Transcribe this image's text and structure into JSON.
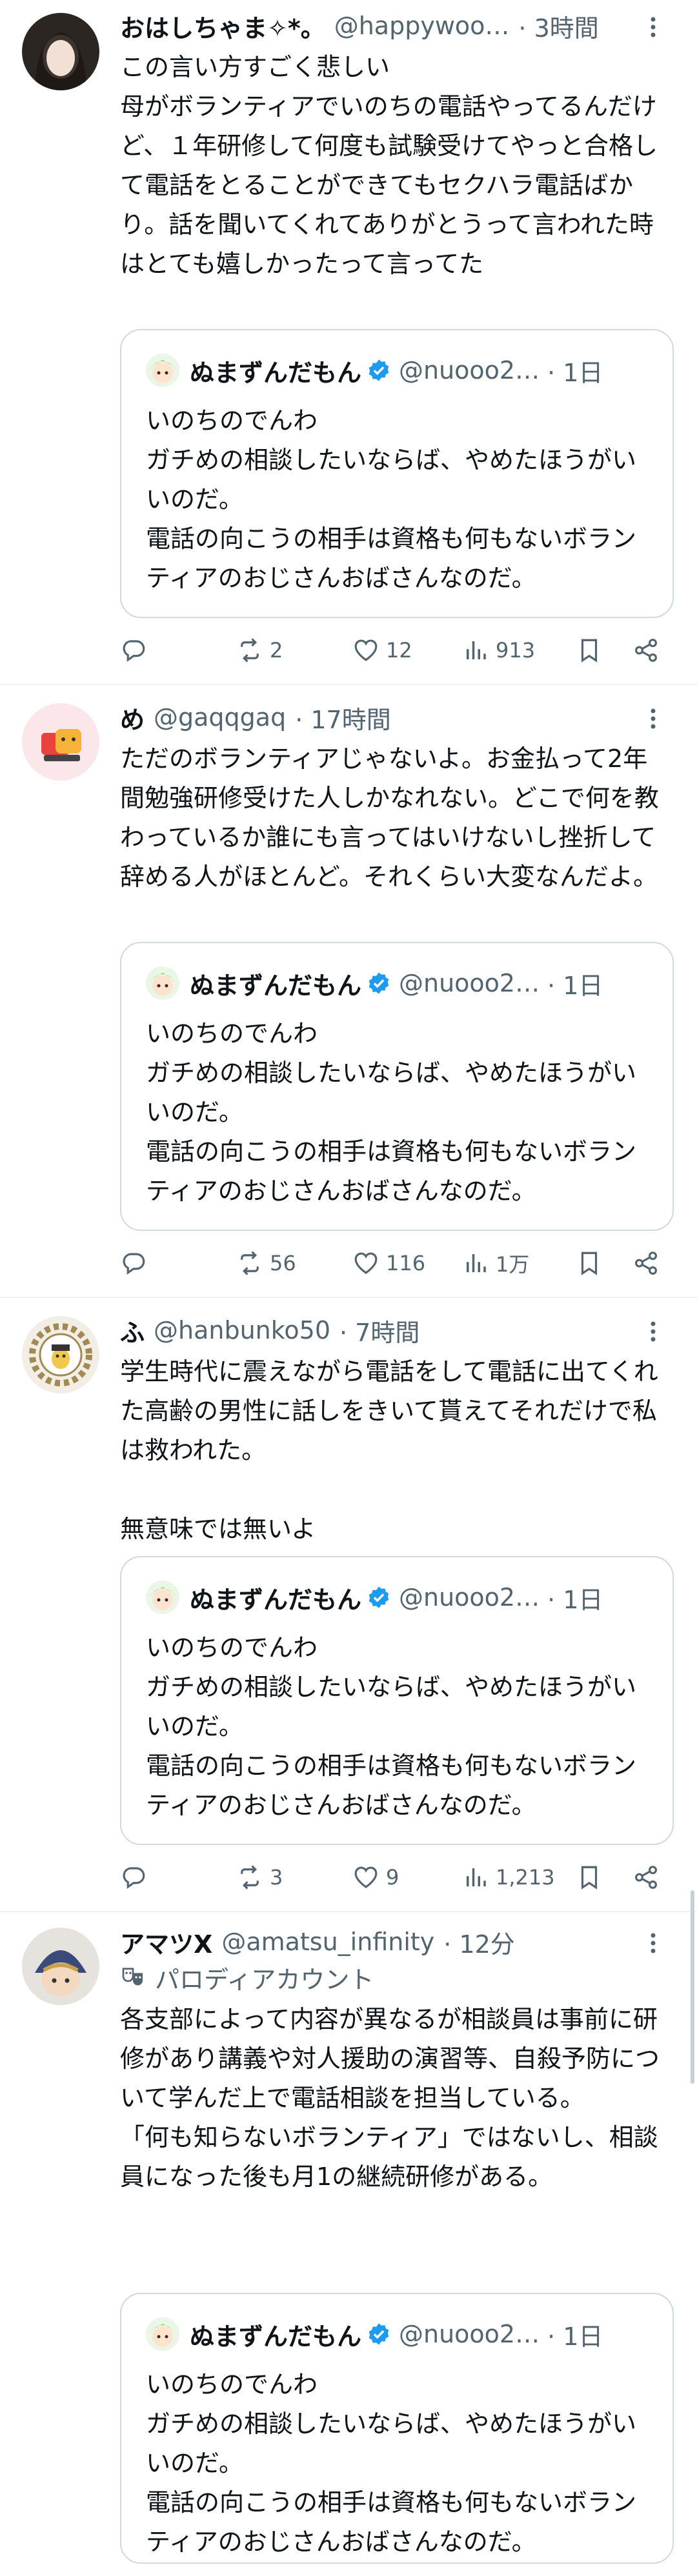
{
  "posts": [
    {
      "name": "おはしちゃま✧*。",
      "handle": "@happywoo…",
      "time": "· 3時間",
      "badge": "",
      "body": "この言い方すごく悲しい\n母がボランティアでいのちの電話やってるんだけど、１年研修して何度も試験受けてやっと合格して電話をとることができてもセクハラ電話ばかり。話を聞いてくれてありがとうって言われた時はとても嬉しかったって言ってた",
      "replies": "",
      "reposts": "2",
      "likes": "12",
      "views": "913"
    },
    {
      "name": "め",
      "handle": "@gaqqgaq",
      "time": "· 17時間",
      "badge": "",
      "body": "ただのボランティアじゃないよ。お金払って2年間勉強研修受けた人しかなれない。どこで何を教わっているか誰にも言ってはいけないし挫折して辞める人がほとんど。それくらい大変なんだよ。",
      "replies": "",
      "reposts": "56",
      "likes": "116",
      "views": "1万"
    },
    {
      "name": "ふ",
      "handle": "@hanbunko50",
      "time": "· 7時間",
      "badge": "",
      "body": "学生時代に震えながら電話をして電話に出てくれた高齢の男性に話しをきいて貰えてそれだけで私は救われた。\n\n無意味では無いよ",
      "replies": "",
      "reposts": "3",
      "likes": "9",
      "views": "1,213"
    },
    {
      "name": "アマツX",
      "handle": "@amatsu_infinity",
      "time": "· 12分",
      "badge": "パロディアカウント",
      "body": "各支部によって内容が異なるが相談員は事前に研修があり講義や対人援助の演習等、自殺予防について学んだ上で電話相談を担当している。\n「何も知らないボランティア」ではないし、相談員になった後も月1の継続研修がある。",
      "replies": "",
      "reposts": "",
      "likes": "",
      "views": ""
    }
  ],
  "quote": {
    "name": "ぬまずんだもん",
    "handle": "@nuooo2…",
    "time": "· 1日",
    "body": "いのちのでんわ\nガチめの相談したいならば、やめたほうがいいのだ。\n電話の向こうの相手は資格も何もないボランティアのおじさんおばさんなのだ。"
  },
  "colors": {
    "text": "#0f1419",
    "secondary": "#536471",
    "verified": "#1d9bf0",
    "border": "#cfd9de",
    "divider": "#eff3f4"
  },
  "icons": [
    "reply-icon",
    "repost-icon",
    "like-icon",
    "views-icon",
    "bookmark-icon",
    "share-icon",
    "more-icon",
    "verified-icon",
    "parody-mask-icon"
  ]
}
